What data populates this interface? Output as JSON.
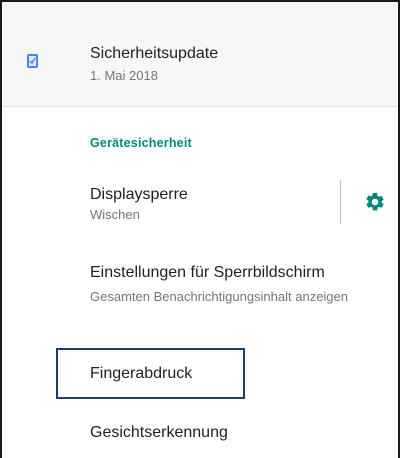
{
  "security_update": {
    "title": "Sicherheitsupdate",
    "date": "1. Mai 2018",
    "icon": "security-update-icon"
  },
  "device_security": {
    "header": "Gerätesicherheit",
    "accent_color": "#00897b"
  },
  "screen_lock": {
    "title": "Displaysperre",
    "value": "Wischen",
    "settings_icon": "gear-icon"
  },
  "lock_screen_settings": {
    "title": "Einstellungen für Sperrbildschirm",
    "summary": "Gesamten Benachrichtigungsinhalt anzeigen"
  },
  "fingerprint": {
    "title": "Fingerabdruck",
    "highlight_color": "#1f3e6b"
  },
  "face_recognition": {
    "title": "Gesichtserkennung"
  }
}
